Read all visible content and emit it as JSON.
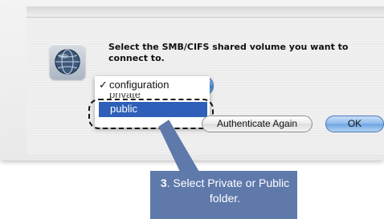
{
  "dialog": {
    "prompt": "Select the SMB/CIFS shared volume you want to connect to."
  },
  "popup": {
    "menu": {
      "checked_mark": "✓",
      "checked_item": "configuration",
      "partial_item": "private",
      "selected_item": "public"
    }
  },
  "buttons": {
    "authenticate_again": "Authenticate Again",
    "ok": "OK"
  },
  "callout": {
    "step_number": "3",
    "text": ". Select Private or Public folder."
  },
  "colors": {
    "callout_bg": "#5f79ab",
    "menu_selection": "#2f5fb8",
    "popup_blue": "#5d9ee8"
  },
  "icons": {
    "network": "network-globe-icon"
  }
}
